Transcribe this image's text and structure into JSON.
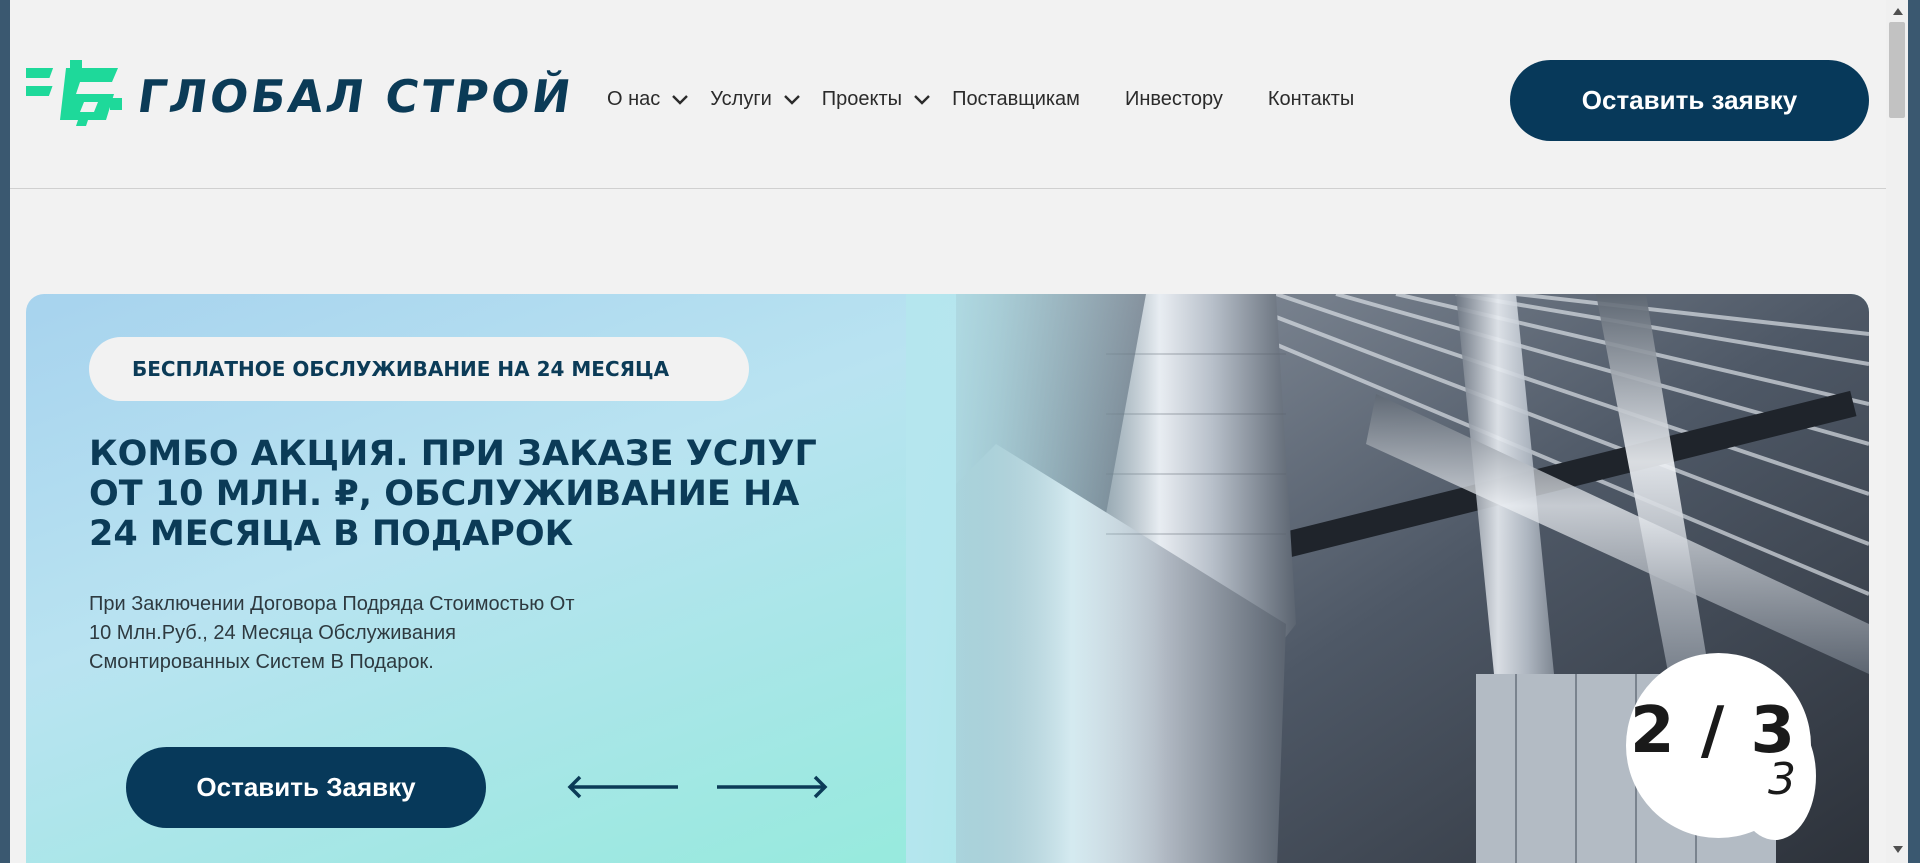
{
  "brand": {
    "name": "ГЛОБАЛ СТРОЙ",
    "accent": "#1ed99a",
    "primary": "#07395a"
  },
  "nav": {
    "items": [
      {
        "label": "О нас",
        "dropdown": true
      },
      {
        "label": "Услуги",
        "dropdown": true
      },
      {
        "label": "Проекты",
        "dropdown": true
      },
      {
        "label": "Поставщикам",
        "dropdown": false
      },
      {
        "label": "Инвестору",
        "dropdown": false
      },
      {
        "label": "Контакты",
        "dropdown": false
      }
    ]
  },
  "header": {
    "cta_label": "Оставить заявку"
  },
  "hero": {
    "badge": "БЕСПЛАТНОЕ ОБСЛУЖИВАНИЕ НА 24 МЕСЯЦА",
    "title_lines": [
      "КОМБО АКЦИЯ. ПРИ ЗАКАЗЕ УСЛУГ",
      "ОТ 10 МЛН. ₽, ОБСЛУЖИВАНИЕ НА",
      "24 МЕСЯЦА В ПОДАРОК"
    ],
    "description_lines": [
      "При Заключении Договора Подряда Стоимостью От",
      "10 Млн.Руб., 24 Месяца Обслуживания",
      "Смонтированных Систем В Подарок."
    ],
    "cta_label": "Оставить Заявку",
    "slide_counter": "2 / 3",
    "slide_total": "3",
    "prev_icon": "arrow-left-icon",
    "next_icon": "arrow-right-icon"
  }
}
